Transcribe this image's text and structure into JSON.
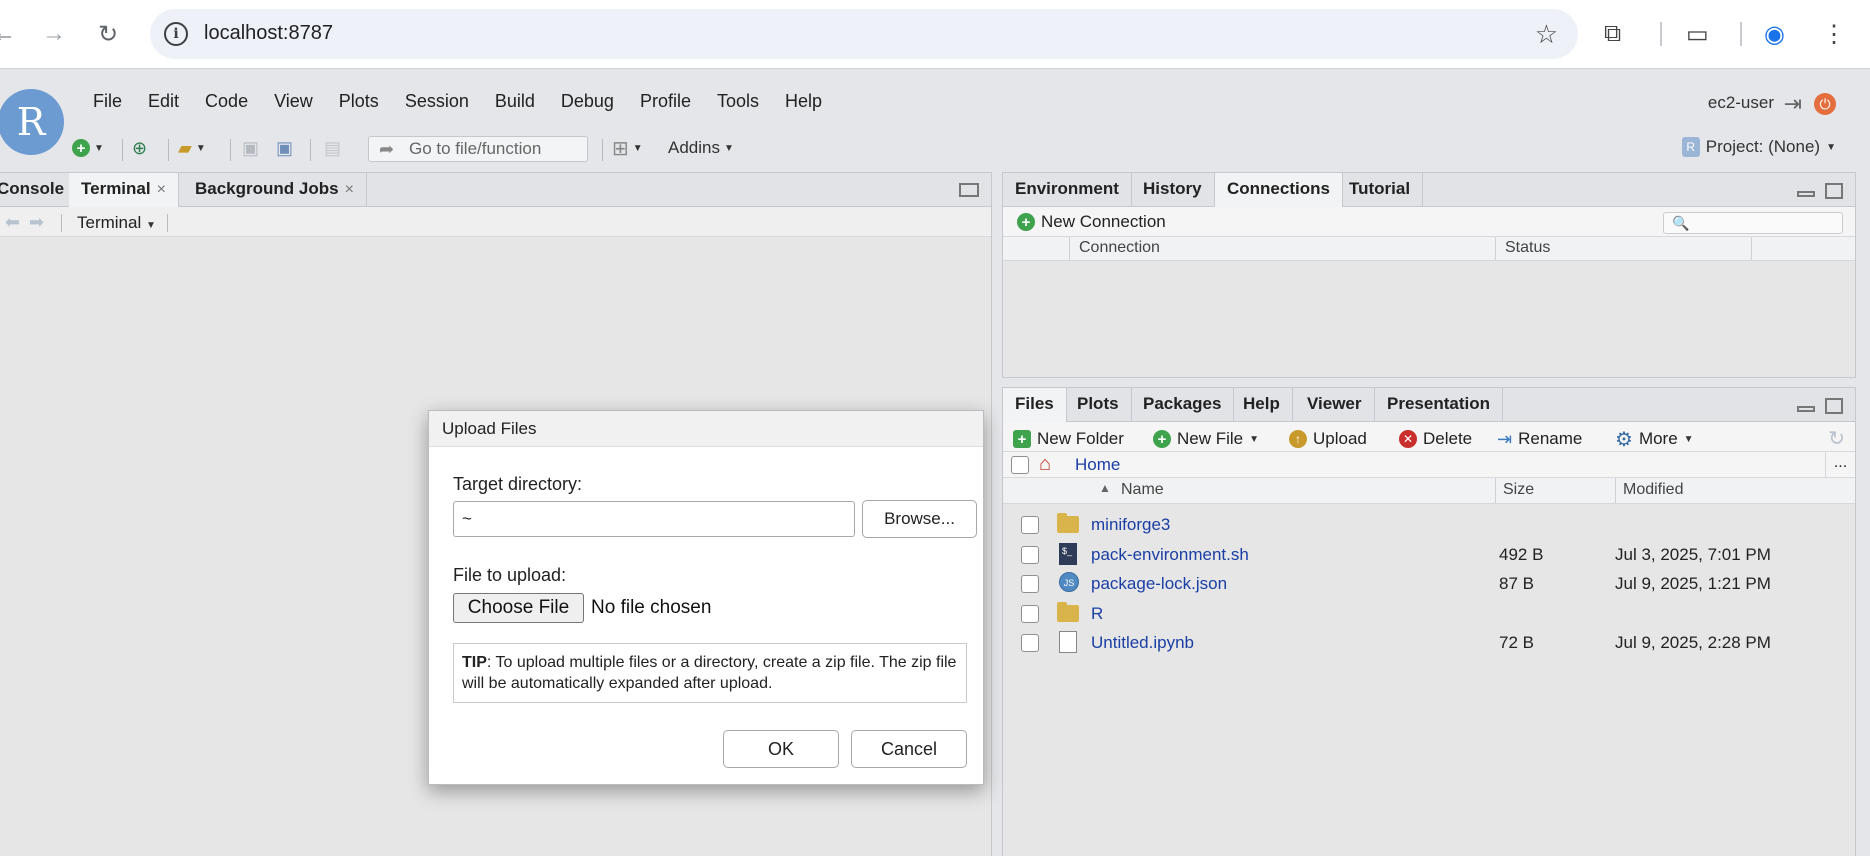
{
  "browser": {
    "url": "localhost:8787",
    "back_icon": "back-arrow-icon",
    "forward_icon": "forward-arrow-icon",
    "reload_icon": "reload-icon"
  },
  "rstudio": {
    "logo_letter": "R",
    "menu": [
      "File",
      "Edit",
      "Code",
      "View",
      "Plots",
      "Session",
      "Build",
      "Debug",
      "Profile",
      "Tools",
      "Help"
    ],
    "user": "ec2-user",
    "goto_placeholder": "Go to file/function",
    "addins_label": "Addins",
    "project_label": "Project: (None)",
    "project_cube": "R"
  },
  "left_pane": {
    "tabs": [
      "Console",
      "Terminal",
      "Background Jobs"
    ],
    "close_mark": "×",
    "terminal_dropdown": "Terminal"
  },
  "env_pane": {
    "tabs": [
      "Environment",
      "History",
      "Connections",
      "Tutorial"
    ],
    "new_connection": "New Connection",
    "columns": [
      "Connection",
      "Status"
    ],
    "search_glyph": "🔍"
  },
  "files_pane": {
    "tabs": [
      "Files",
      "Plots",
      "Packages",
      "Help",
      "Viewer",
      "Presentation"
    ],
    "toolbar": {
      "new_folder": "New Folder",
      "new_file": "New File",
      "upload": "Upload",
      "delete": "Delete",
      "rename": "Rename",
      "more": "More"
    },
    "breadcrumb": "Home",
    "more_dots": "...",
    "columns": {
      "name": "Name",
      "size": "Size",
      "modified": "Modified"
    },
    "sort_arrow": "▲",
    "rows": [
      {
        "name": "miniforge3",
        "type": "folder",
        "size": "",
        "modified": ""
      },
      {
        "name": "pack-environment.sh",
        "type": "sh",
        "size": "492 B",
        "modified": "Jul 3, 2025, 7:01 PM"
      },
      {
        "name": "package-lock.json",
        "type": "json",
        "size": "87 B",
        "modified": "Jul 9, 2025, 1:21 PM"
      },
      {
        "name": "R",
        "type": "folder",
        "size": "",
        "modified": ""
      },
      {
        "name": "Untitled.ipynb",
        "type": "file",
        "size": "72 B",
        "modified": "Jul 9, 2025, 2:28 PM"
      }
    ]
  },
  "dialog": {
    "title": "Upload Files",
    "target_label": "Target directory:",
    "target_value": "~",
    "browse_label": "Browse...",
    "file_label": "File to upload:",
    "choose_label": "Choose File",
    "no_file": "No file chosen",
    "tip_bold": "TIP",
    "tip_text": ": To upload multiple files or a directory, create a zip file. The zip file will be automatically expanded after upload.",
    "ok_label": "OK",
    "cancel_label": "Cancel"
  }
}
